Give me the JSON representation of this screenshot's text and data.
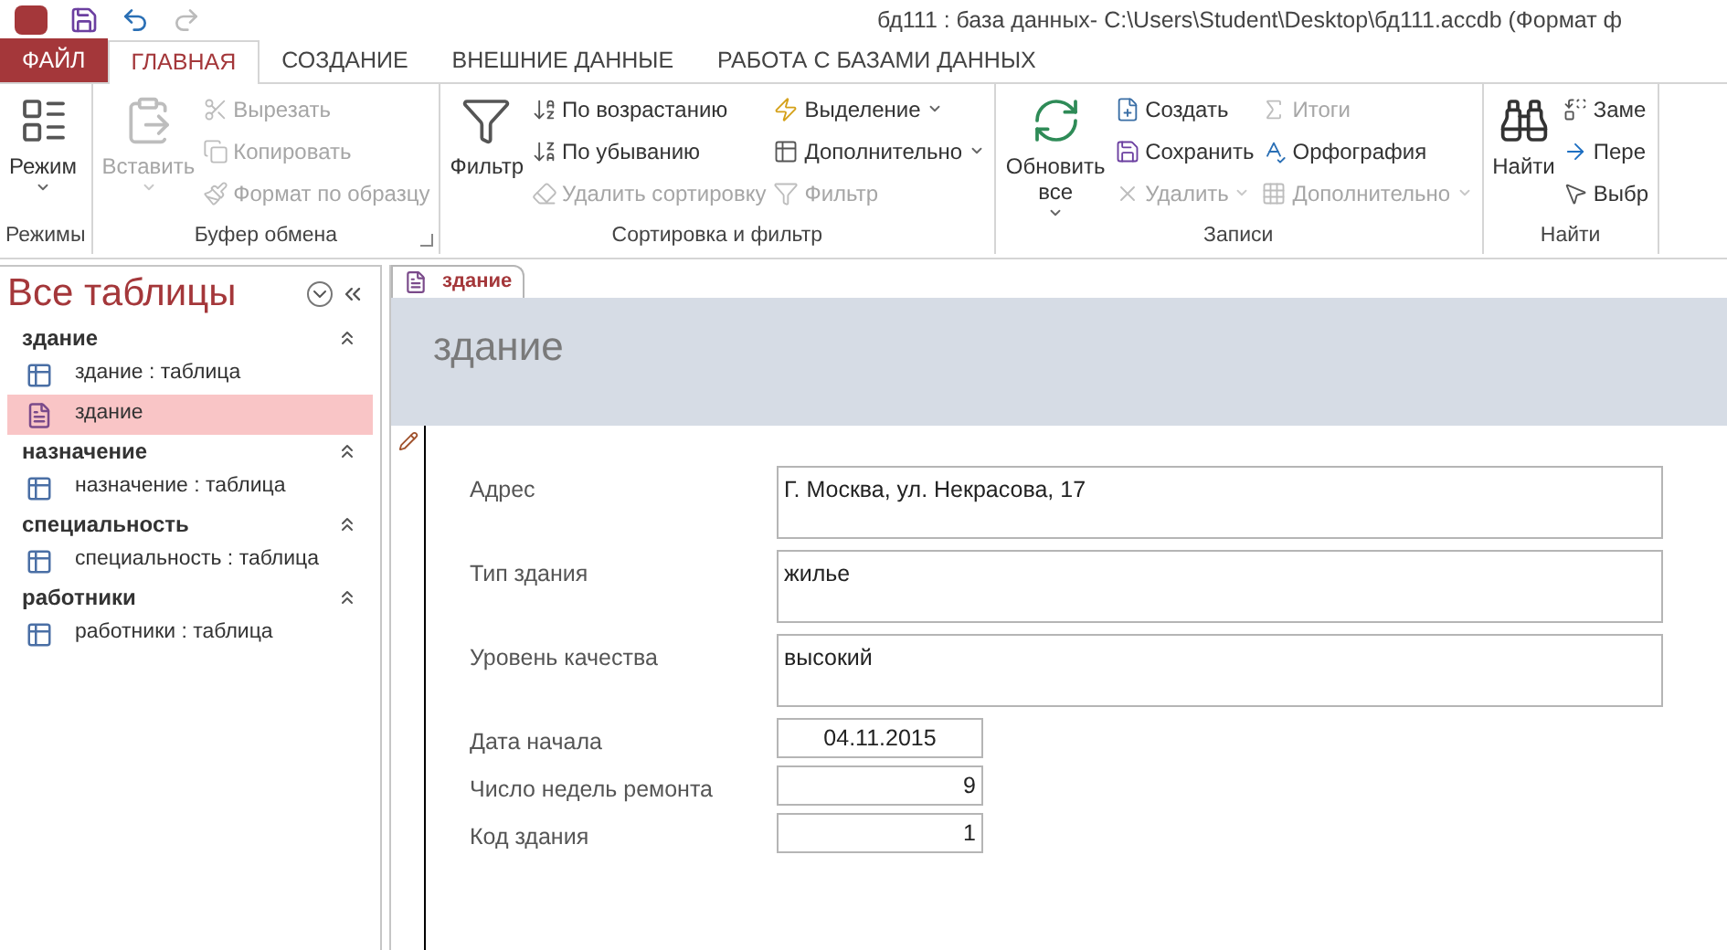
{
  "window": {
    "title": "бд111 : база данных- C:\\Users\\Student\\Desktop\\бд111.accdb (Формат ф"
  },
  "menu_tabs": [
    {
      "label": "ФАЙЛ",
      "kind": "file",
      "selected": false
    },
    {
      "label": "ГЛАВНАЯ",
      "kind": "tab",
      "selected": true
    },
    {
      "label": "СОЗДАНИЕ",
      "kind": "tab",
      "selected": false
    },
    {
      "label": "ВНЕШНИЕ ДАННЫЕ",
      "kind": "tab",
      "selected": false
    },
    {
      "label": "РАБОТА С БАЗАМИ ДАННЫХ",
      "kind": "tab",
      "selected": false
    }
  ],
  "ribbon": {
    "groups": [
      {
        "label": "Режимы",
        "launcher": false,
        "large": [
          {
            "label": "Режим",
            "disabled": false,
            "dropdown": true
          }
        ]
      },
      {
        "label": "Буфер обмена",
        "launcher": true,
        "large": [
          {
            "label": "Вставить",
            "disabled": true,
            "dropdown": true
          }
        ],
        "columns": [
          [
            {
              "label": "Вырезать",
              "disabled": true,
              "dropdown": false
            },
            {
              "label": "Копировать",
              "disabled": true,
              "dropdown": false
            },
            {
              "label": "Формат по образцу",
              "disabled": true,
              "dropdown": false
            }
          ]
        ]
      },
      {
        "label": "Сортировка и фильтр",
        "launcher": false,
        "large": [
          {
            "label": "Фильтр",
            "disabled": false,
            "dropdown": false
          }
        ],
        "columns": [
          [
            {
              "label": "По возрастанию",
              "disabled": false,
              "dropdown": false
            },
            {
              "label": "По убыванию",
              "disabled": false,
              "dropdown": false
            },
            {
              "label": "Удалить сортировку",
              "disabled": true,
              "dropdown": false
            }
          ],
          [
            {
              "label": "Выделение",
              "disabled": false,
              "dropdown": true
            },
            {
              "label": "Дополнительно",
              "disabled": false,
              "dropdown": true
            },
            {
              "label": "Фильтр",
              "disabled": true,
              "dropdown": false
            }
          ]
        ]
      },
      {
        "label": "Записи",
        "launcher": false,
        "large": [
          {
            "label": "Обновить все",
            "disabled": false,
            "dropdown": true
          }
        ],
        "columns": [
          [
            {
              "label": "Создать",
              "disabled": false,
              "dropdown": false
            },
            {
              "label": "Сохранить",
              "disabled": false,
              "dropdown": false
            },
            {
              "label": "Удалить",
              "disabled": true,
              "dropdown": true
            }
          ],
          [
            {
              "label": "Итоги",
              "disabled": true,
              "dropdown": false
            },
            {
              "label": "Орфография",
              "disabled": false,
              "dropdown": false
            },
            {
              "label": "Дополнительно",
              "disabled": true,
              "dropdown": true
            }
          ]
        ]
      },
      {
        "label": "Найти",
        "launcher": false,
        "large": [
          {
            "label": "Найти",
            "disabled": false,
            "dropdown": false
          }
        ],
        "columns": [
          [
            {
              "label": "Заме",
              "disabled": false,
              "dropdown": false
            },
            {
              "label": "Пере",
              "disabled": false,
              "dropdown": false
            },
            {
              "label": "Выбр",
              "disabled": false,
              "dropdown": false
            }
          ]
        ]
      }
    ]
  },
  "navigation": {
    "title": "Все таблицы",
    "groups": [
      {
        "name": "здание",
        "expanded": true,
        "items": [
          {
            "label": "здание : таблица",
            "kind": "table",
            "selected": false
          },
          {
            "label": "здание",
            "kind": "form",
            "selected": true
          }
        ]
      },
      {
        "name": "назначение",
        "expanded": true,
        "items": [
          {
            "label": "назначение : таблица",
            "kind": "table",
            "selected": false
          }
        ]
      },
      {
        "name": "специальность",
        "expanded": true,
        "items": [
          {
            "label": "специальность : таблица",
            "kind": "table",
            "selected": false
          }
        ]
      },
      {
        "name": "работники",
        "expanded": true,
        "items": [
          {
            "label": "работники : таблица",
            "kind": "table",
            "selected": false
          }
        ]
      }
    ]
  },
  "document": {
    "tab": {
      "label": "здание",
      "selected": true
    },
    "header": "здание",
    "fields": [
      {
        "label": "Адрес",
        "value": "Г. Москва, ул. Некрасова, 17",
        "kind": "memo"
      },
      {
        "label": "Тип здания",
        "value": "жилье",
        "kind": "memo"
      },
      {
        "label": "Уровень качества",
        "value": "высокий",
        "kind": "memo"
      },
      {
        "label": "Дата начала",
        "value": "04.11.2015",
        "kind": "date"
      },
      {
        "label": "Число недель ремонта",
        "value": "9",
        "kind": "number"
      },
      {
        "label": "Код здания",
        "value": "1",
        "kind": "number"
      }
    ]
  }
}
